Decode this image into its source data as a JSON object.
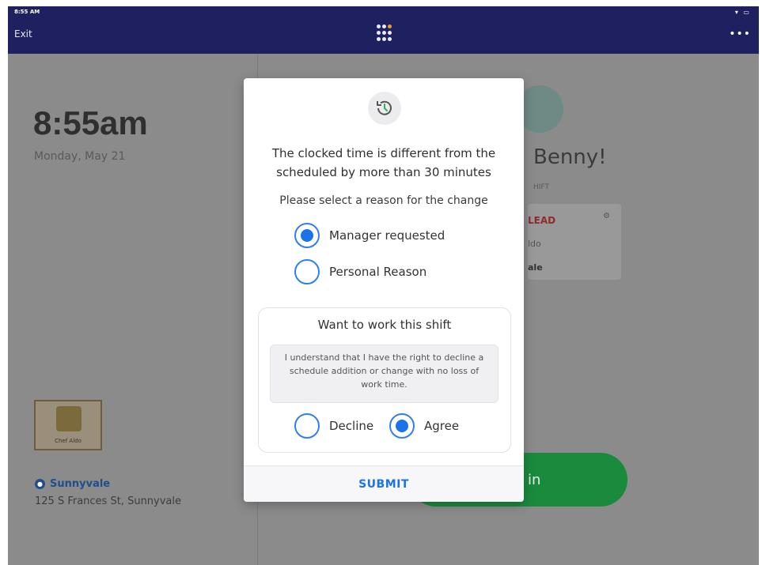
{
  "status_bar": {
    "time": "8:55 AM",
    "icons": "὏6 ▮"
  },
  "topbar": {
    "exit_label": "Exit",
    "more_label": "•••",
    "apps_icon": "grid-icon"
  },
  "left_panel": {
    "time": "8:55am",
    "date": "Monday, May 21",
    "logo_text": "Chef Aldo",
    "location_name": "Sunnyvale",
    "address": "125 S Frances St, Sunnyvale"
  },
  "right_panel": {
    "greeting": "Benny!",
    "shift_label": "HIFT",
    "shift_role": "LEAD",
    "shift_place": "ldo",
    "shift_city": "ale",
    "clock_label": "in"
  },
  "modal": {
    "icon": "history-clock-icon",
    "message": "The clocked time is different from the scheduled by more than 30 minutes",
    "prompt": "Please select a reason for the change",
    "reasons": [
      {
        "label": "Manager requested",
        "selected": true
      },
      {
        "label": "Personal Reason",
        "selected": false
      }
    ],
    "work_shift": {
      "title": "Want to work this shift",
      "disclaimer": "I understand that I have the right to decline a schedule addition or change with no loss of work time.",
      "options": [
        {
          "label": "Decline",
          "selected": false
        },
        {
          "label": "Agree",
          "selected": true
        }
      ]
    },
    "submit_label": "SUBMIT"
  },
  "colors": {
    "topbar": "#1f2060",
    "accent": "#1a73e8",
    "clock_button": "#1a8a3c"
  }
}
